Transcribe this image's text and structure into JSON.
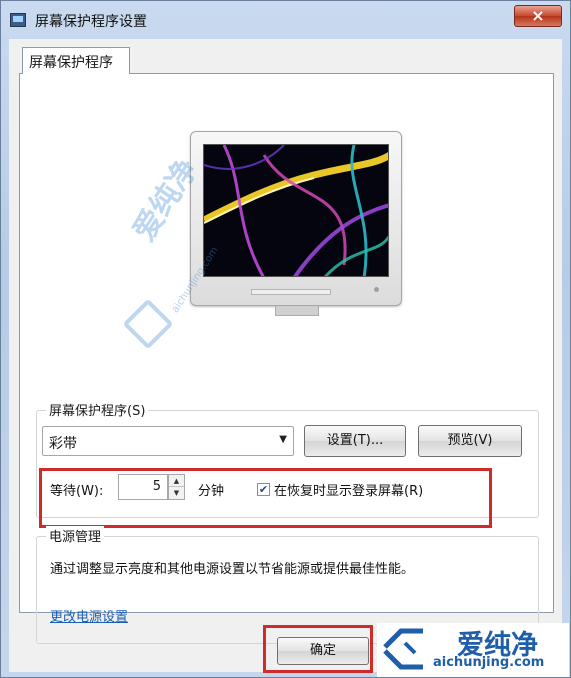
{
  "window": {
    "title": "屏幕保护程序设置",
    "close_symbol": "×"
  },
  "tab": {
    "label": "屏幕保护程序"
  },
  "screensaver": {
    "group_label": "屏幕保护程序(S)",
    "selected": "彩带",
    "settings_button": "设置(T)...",
    "preview_button": "预览(V)",
    "wait_label": "等待(W):",
    "wait_value": "5",
    "wait_unit": "分钟",
    "resume_checkbox_label": "在恢复时显示登录屏幕(R)",
    "resume_checked": true
  },
  "power": {
    "group_label": "电源管理",
    "description": "通过调整显示亮度和其他电源设置以节省能源或提供最佳性能。",
    "link": "更改电源设置"
  },
  "footer": {
    "ok_button": "确定"
  },
  "watermark": {
    "mid_text": "爱纯净",
    "mid_url": "aichunjing.com",
    "corner_title": "爱纯净",
    "corner_url": "aichunjing.com"
  },
  "colors": {
    "highlight_red": "#cf2b2b",
    "link_blue": "#1a5fb4",
    "watermark_blue": "#1f5ea8"
  }
}
